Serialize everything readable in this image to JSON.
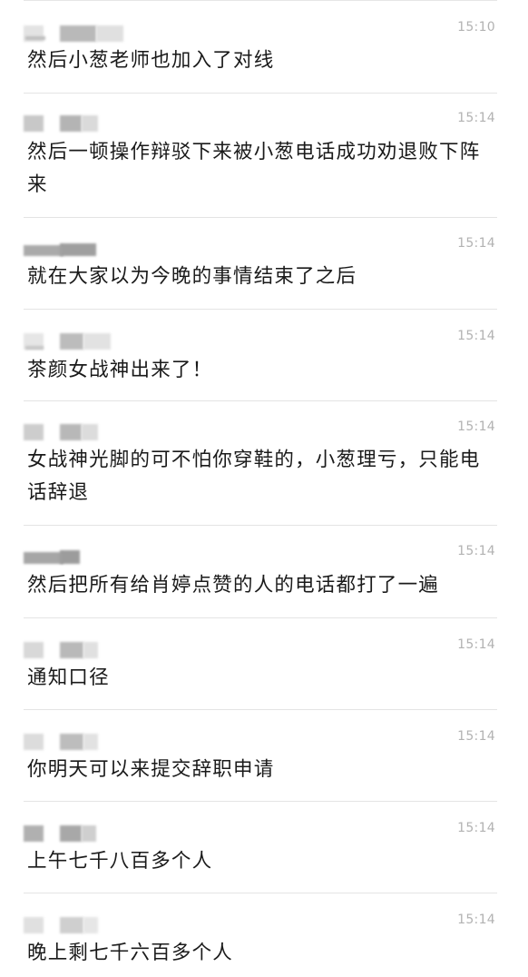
{
  "messages": [
    {
      "time": "15:10",
      "text": "然后小葱老师也加入了对线"
    },
    {
      "time": "15:14",
      "text": "然后一顿操作辩驳下来被小葱电话成功劝退败下阵来"
    },
    {
      "time": "15:14",
      "text": "就在大家以为今晚的事情结束了之后"
    },
    {
      "time": "15:14",
      "text": "茶颜女战神出来了！"
    },
    {
      "time": "15:14",
      "text": "女战神光脚的可不怕你穿鞋的，小葱理亏，只能电话辞退"
    },
    {
      "time": "15:14",
      "text": "然后把所有给肖婷点赞的人的电话都打了一遍"
    },
    {
      "time": "15:14",
      "text": "通知口径"
    },
    {
      "time": "15:14",
      "text": "你明天可以来提交辞职申请"
    },
    {
      "time": "15:14",
      "text": "上午七千八百多个人"
    },
    {
      "time": "15:14",
      "text": "晚上剩七千六百多个人"
    }
  ]
}
